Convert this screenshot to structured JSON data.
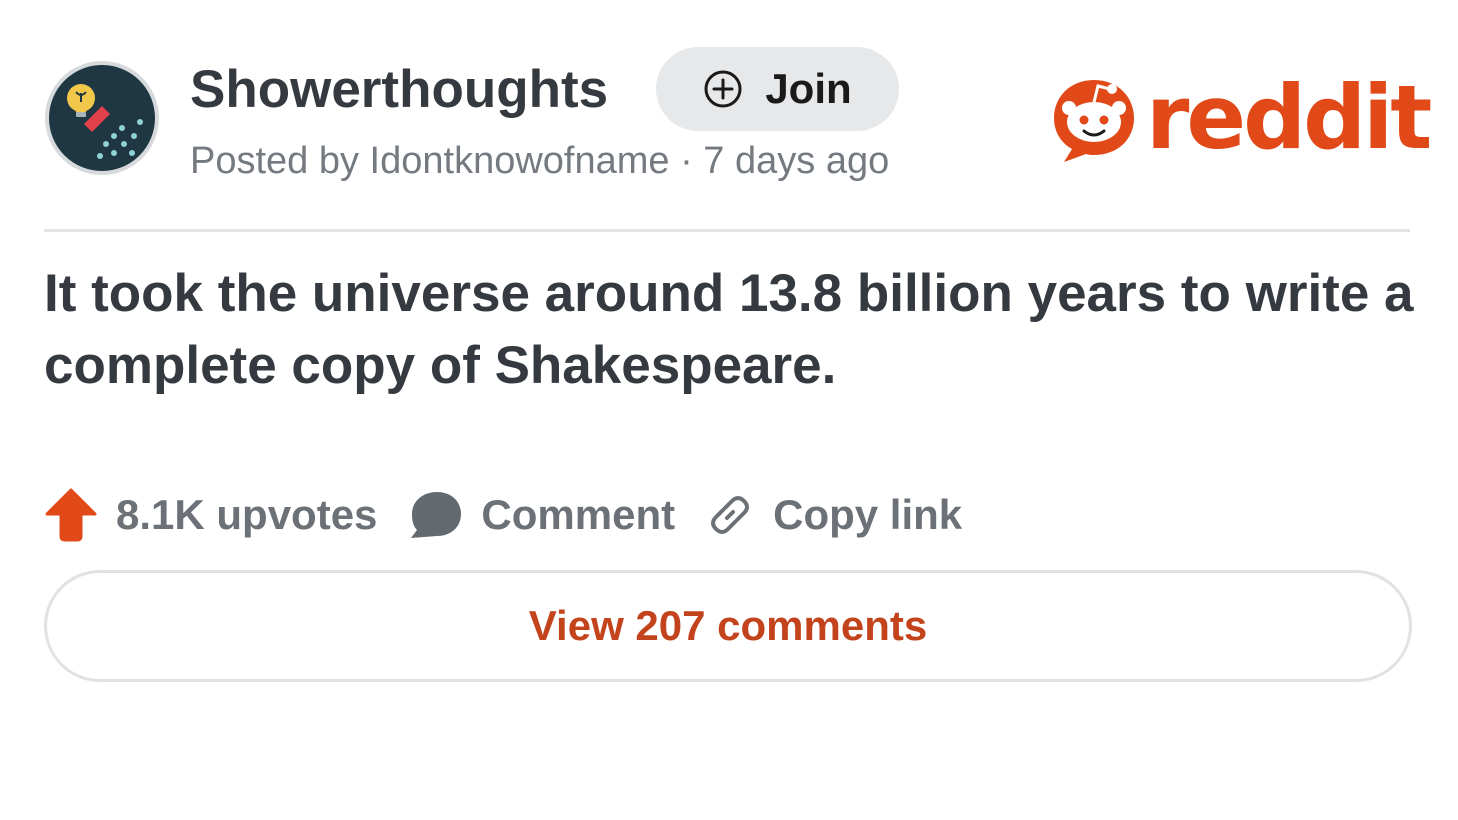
{
  "subreddit": {
    "name": "Showerthoughts",
    "join_label": "Join",
    "avatar_icon": "lightbulb-shower-icon"
  },
  "post": {
    "meta": "Posted by Idontknowofname · 7 days ago",
    "title": "It took the universe around 13.8 billion years to write a complete copy of Shakespeare."
  },
  "brand": {
    "wordmark": "reddit",
    "color": "#e14a18"
  },
  "actions": {
    "upvotes_label": "8.1K upvotes",
    "comment_label": "Comment",
    "copy_link_label": "Copy link",
    "upvote_color": "#e14a18"
  },
  "comments": {
    "view_label": "View 207 comments"
  }
}
